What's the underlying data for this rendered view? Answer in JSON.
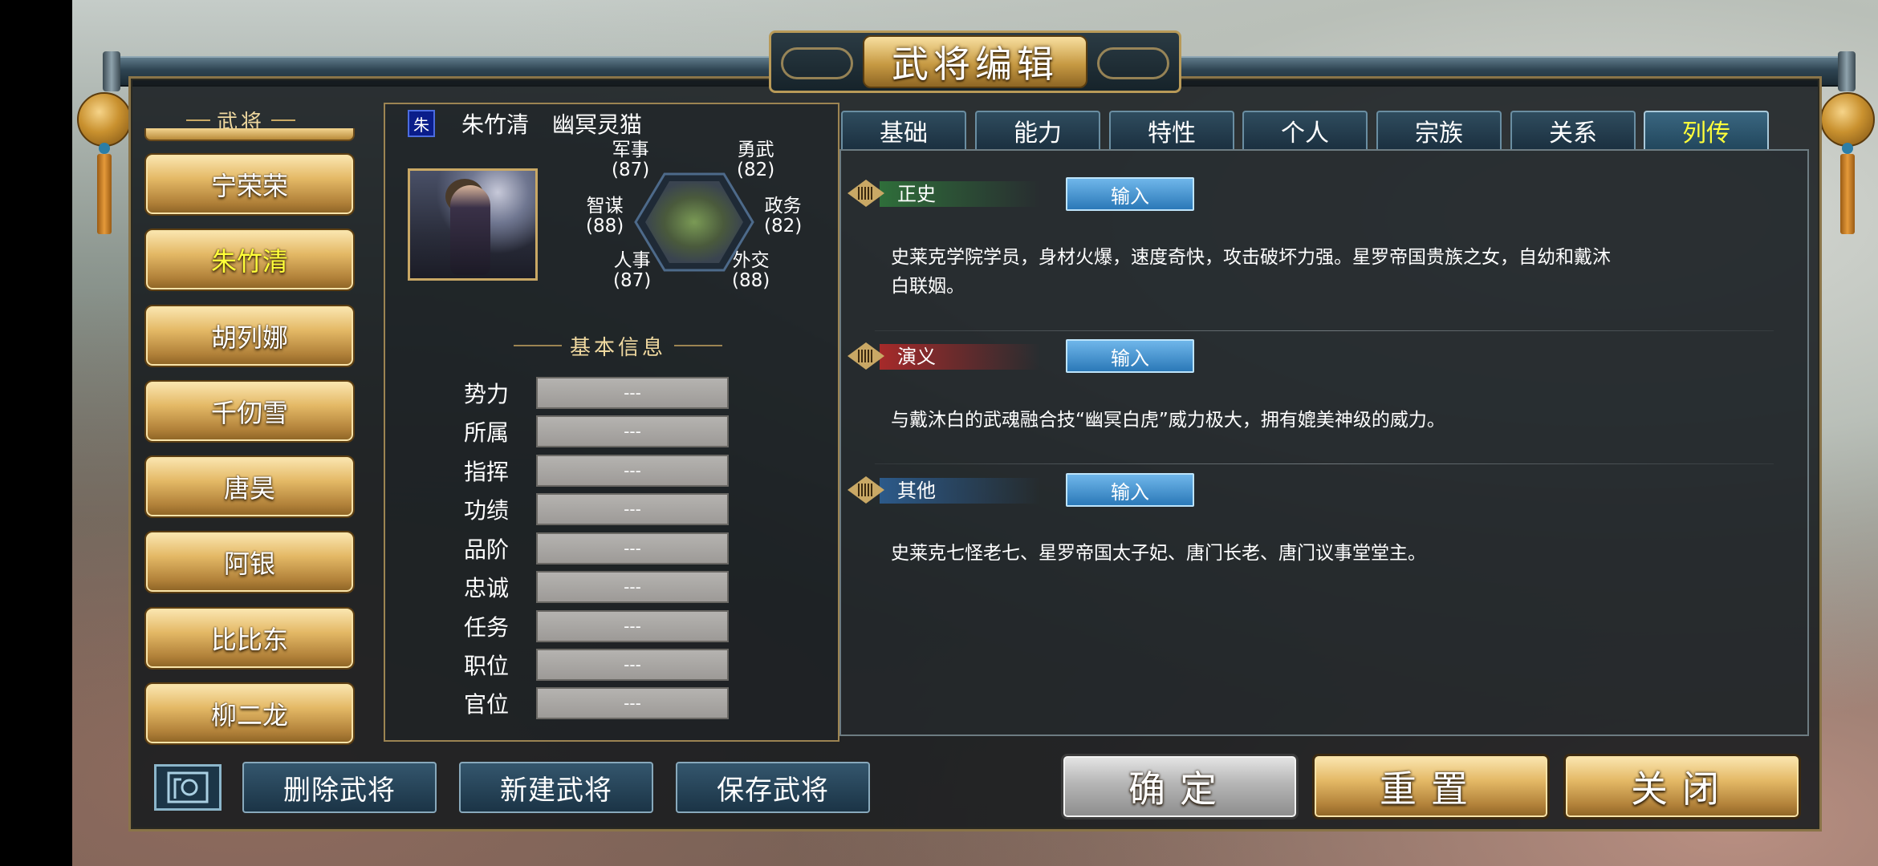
{
  "window": {
    "title": "武将编辑"
  },
  "character_list": {
    "header": "武将",
    "items": [
      {
        "label": "宁荣荣",
        "selected": false
      },
      {
        "label": "朱竹清",
        "selected": true
      },
      {
        "label": "胡列娜",
        "selected": false
      },
      {
        "label": "千仞雪",
        "selected": false
      },
      {
        "label": "唐昊",
        "selected": false
      },
      {
        "label": "阿银",
        "selected": false
      },
      {
        "label": "比比东",
        "selected": false
      },
      {
        "label": "柳二龙",
        "selected": false
      }
    ]
  },
  "character": {
    "faction_badge": "朱",
    "name": "朱竹清",
    "title": "幽冥灵猫",
    "portrait_icon": "character-portrait"
  },
  "stats": {
    "military": {
      "label": "军事",
      "value": "(87)"
    },
    "valor": {
      "label": "勇武",
      "value": "(82)"
    },
    "strategy": {
      "label": "智谋",
      "value": "(88)"
    },
    "politics": {
      "label": "政务",
      "value": "(82)"
    },
    "personnel": {
      "label": "人事",
      "value": "(87)"
    },
    "diplomacy": {
      "label": "外交",
      "value": "(88)"
    }
  },
  "basic_info": {
    "header": "基本信息",
    "rows": [
      {
        "label": "势力",
        "value": "---"
      },
      {
        "label": "所属",
        "value": "---"
      },
      {
        "label": "指挥",
        "value": "---"
      },
      {
        "label": "功绩",
        "value": "---"
      },
      {
        "label": "品阶",
        "value": "---"
      },
      {
        "label": "忠诚",
        "value": "---"
      },
      {
        "label": "任务",
        "value": "---"
      },
      {
        "label": "职位",
        "value": "---"
      },
      {
        "label": "官位",
        "value": "---"
      }
    ]
  },
  "tabs": [
    {
      "label": "基础",
      "active": false
    },
    {
      "label": "能力",
      "active": false
    },
    {
      "label": "特性",
      "active": false
    },
    {
      "label": "个人",
      "active": false
    },
    {
      "label": "宗族",
      "active": false
    },
    {
      "label": "关系",
      "active": false
    },
    {
      "label": "列传",
      "active": true
    }
  ],
  "biography": {
    "sections": [
      {
        "title": "正史",
        "color": "#2f6e3a",
        "input_label": "输入",
        "text_line1": "史莱克学院学员，身材火爆，速度奇快，攻击破坏力强。星罗帝国贵族之女，自幼和戴沐",
        "text_line2": "白联姻。"
      },
      {
        "title": "演义",
        "color": "#a62a2a",
        "input_label": "输入",
        "text_line1": "与戴沐白的武魂融合技“幽冥白虎”威力极大，拥有媲美神级的威力。",
        "text_line2": ""
      },
      {
        "title": "其他",
        "color": "#2c5a8a",
        "input_label": "输入",
        "text_line1": "史莱克七怪老七、星罗帝国太子妃、唐门长老、唐门议事堂堂主。",
        "text_line2": ""
      }
    ]
  },
  "bottom_bar": {
    "avatar_icon": "portrait-frame-icon",
    "delete_label": "删除武将",
    "new_label": "新建武将",
    "save_label": "保存武将",
    "confirm_label": "确定",
    "reset_label": "重置",
    "close_label": "关闭"
  },
  "colors": {
    "selected_text": "#ffff3a",
    "gold_button": "#e4b966",
    "tab_blue": "#2f4c5e",
    "input_blue": "#2b79b8"
  }
}
